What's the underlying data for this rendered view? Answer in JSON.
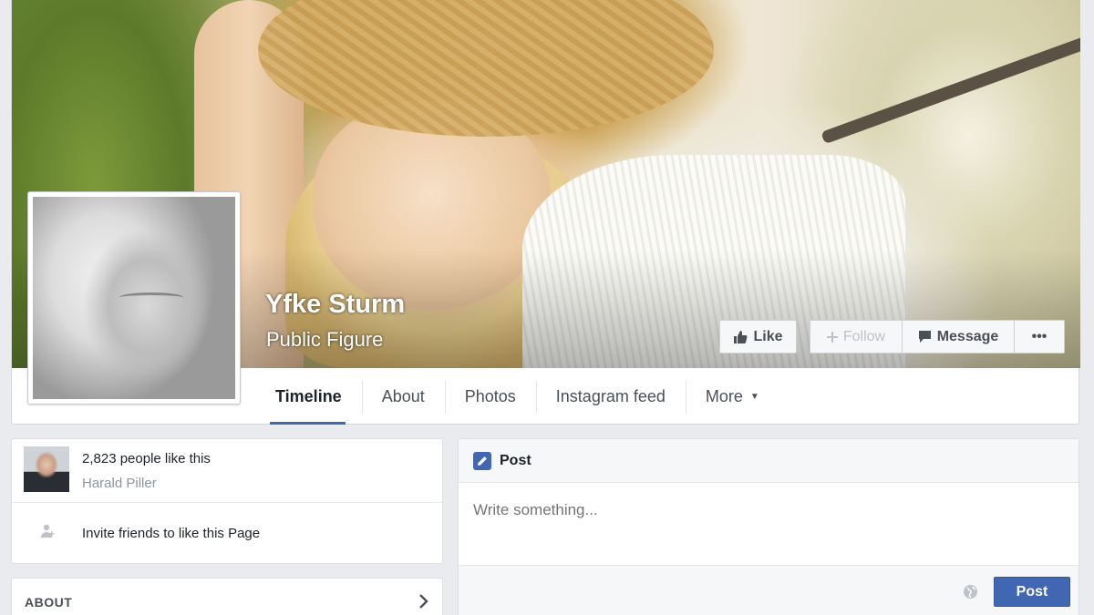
{
  "page": {
    "name": "Yfke Sturm",
    "category": "Public Figure"
  },
  "actions": {
    "like_label": "Like",
    "follow_label": "Follow",
    "message_label": "Message",
    "more_label": "•••"
  },
  "tabs": [
    {
      "label": "Timeline",
      "active": true
    },
    {
      "label": "About",
      "active": false
    },
    {
      "label": "Photos",
      "active": false
    },
    {
      "label": "Instagram feed",
      "active": false
    },
    {
      "label": "More",
      "active": false
    }
  ],
  "likes": {
    "count_text": "2,823 people like this",
    "friend_name": "Harald Piller",
    "invite_text": "Invite friends to like this Page"
  },
  "about": {
    "title": "ABOUT"
  },
  "composer": {
    "title": "Post",
    "placeholder": "Write something...",
    "post_button": "Post"
  },
  "colors": {
    "brand_blue": "#4267b2",
    "background": "#e9ebee"
  },
  "icons": [
    "thumbs-up-icon",
    "plus-icon",
    "speech-bubble-icon",
    "ellipsis-icon",
    "caret-down-icon",
    "person-add-icon",
    "chevron-right-icon",
    "pencil-icon",
    "globe-icon"
  ]
}
